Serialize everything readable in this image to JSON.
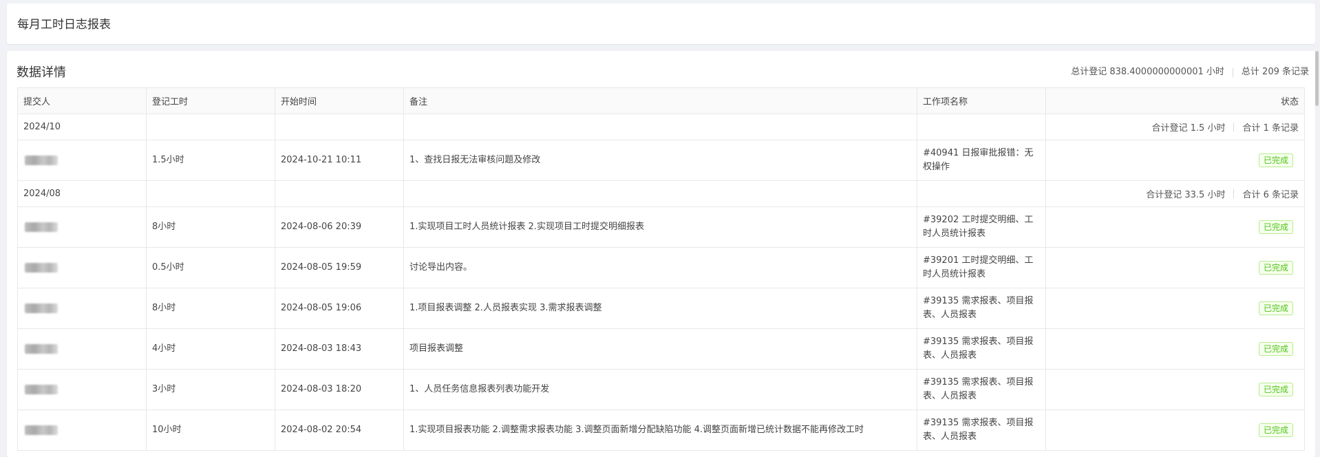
{
  "page": {
    "title": "每月工时日志报表"
  },
  "details": {
    "title": "数据详情",
    "summary_hours": "总计登记 838.4000000000001 小时",
    "summary_count": "总计 209 条记录"
  },
  "columns": [
    "提交人",
    "登记工时",
    "开始时间",
    "备注",
    "工作项名称",
    "状态"
  ],
  "groups": [
    {
      "month": "2024/10",
      "hours": "合计登记 1.5 小时",
      "count": "合计 1 条记录",
      "rows": [
        {
          "hours": "1.5小时",
          "start": "2024-10-21 10:11",
          "note": "1、查找日报无法审核问题及修改",
          "work": "#40941 日报审批报错：无权操作",
          "status": "已完成"
        }
      ]
    },
    {
      "month": "2024/08",
      "hours": "合计登记 33.5 小时",
      "count": "合计 6 条记录",
      "rows": [
        {
          "hours": "8小时",
          "start": "2024-08-06 20:39",
          "note": "1.实现项目工时人员统计报表 2.实现项目工时提交明细报表",
          "work": "#39202 工时提交明细、工时人员统计报表",
          "status": "已完成"
        },
        {
          "hours": "0.5小时",
          "start": "2024-08-05 19:59",
          "note": "讨论导出内容。",
          "work": "#39201 工时提交明细、工时人员统计报表",
          "status": "已完成"
        },
        {
          "hours": "8小时",
          "start": "2024-08-05 19:06",
          "note": "1.项目报表调整 2.人员报表实现 3.需求报表调整",
          "work": "#39135 需求报表、项目报表、人员报表",
          "status": "已完成"
        },
        {
          "hours": "4小时",
          "start": "2024-08-03 18:43",
          "note": "项目报表调整",
          "work": "#39135 需求报表、项目报表、人员报表",
          "status": "已完成"
        },
        {
          "hours": "3小时",
          "start": "2024-08-03 18:20",
          "note": "1、人员任务信息报表列表功能开发",
          "work": "#39135 需求报表、项目报表、人员报表",
          "status": "已完成"
        },
        {
          "hours": "10小时",
          "start": "2024-08-02 20:54",
          "note": "1.实现项目报表功能 2.调整需求报表功能 3.调整页面新增分配缺陷功能 4.调整页面新增已统计数据不能再修改工时",
          "work": "#39135 需求报表、项目报表、人员报表",
          "status": "已完成"
        }
      ]
    }
  ]
}
